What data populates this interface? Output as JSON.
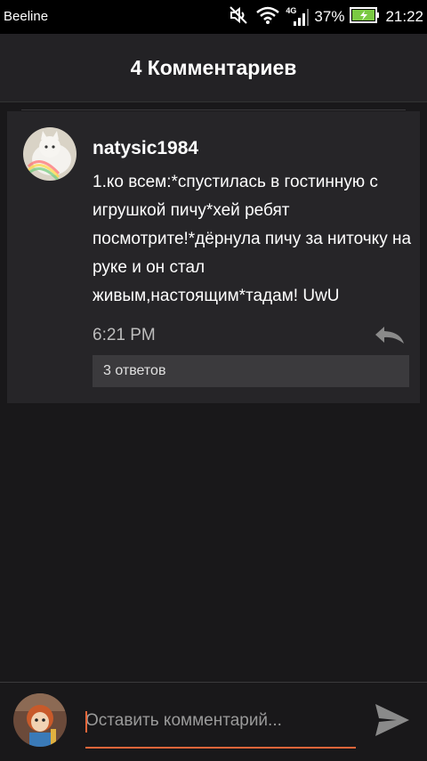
{
  "status_bar": {
    "carrier": "Beeline",
    "network_type": "4G",
    "battery_percent": "37%",
    "time": "21:22",
    "icons": [
      "mute-icon",
      "wifi-icon",
      "signal-icon",
      "battery-charging-icon"
    ]
  },
  "header": {
    "title": "4 Комментариев"
  },
  "comment": {
    "username": "natysic1984",
    "avatar_icon": "cat-avatar",
    "text": "1.ко всем:*спустилась в гостинную с игрушкой пичу*хей ребят посмотрите!*дёрнула пичу за ниточку на руке и он стал живым,настоящим*тадам! UwU",
    "time": "6:21 PM",
    "reply_icon": "reply-icon",
    "replies_label": "3 ответов"
  },
  "composer": {
    "placeholder": "Оставить комментарий...",
    "value": "",
    "send_icon": "send-icon"
  },
  "colors": {
    "accent": "#e8663a",
    "background": "#19181a",
    "card": "#262528",
    "header": "#232225"
  }
}
